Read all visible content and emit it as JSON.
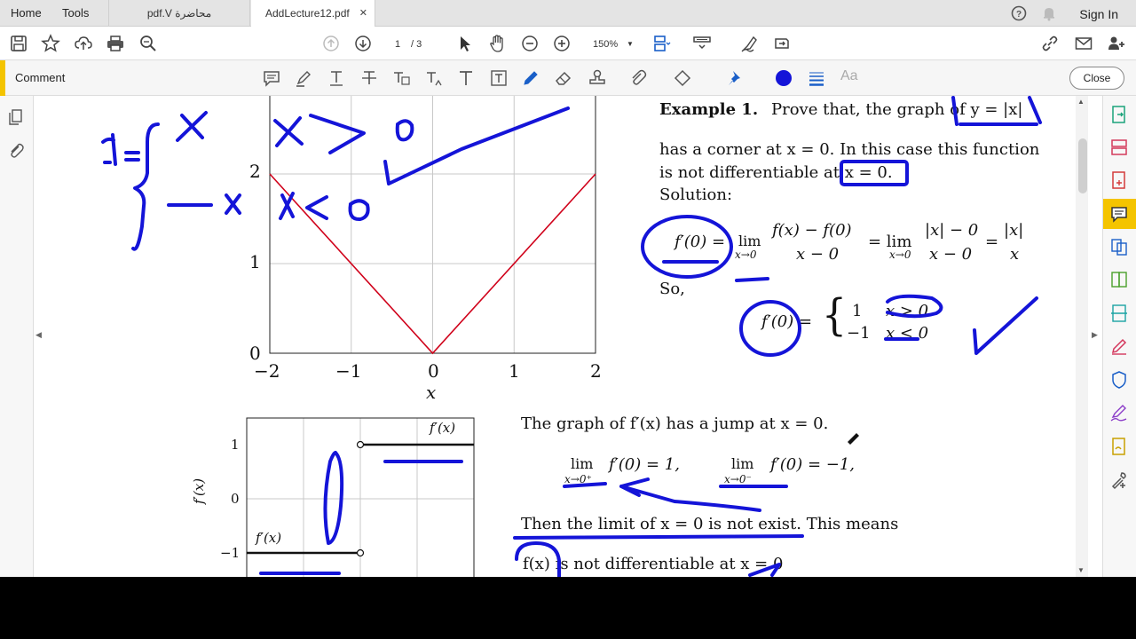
{
  "menu": {
    "home": "Home",
    "tools": "Tools"
  },
  "tabs": [
    {
      "label": "pdf.V محاضرة"
    },
    {
      "label": "AddLecture12.pdf"
    }
  ],
  "account": {
    "sign_in": "Sign In"
  },
  "nav": {
    "current_page": "1",
    "total_pages": "/ 3",
    "zoom": "150%"
  },
  "comment_toolbar": {
    "title": "Comment",
    "font_label": "Aa",
    "close_label": "Close"
  },
  "document": {
    "example_heading": "Example 1.",
    "example_text": "Prove that, the graph of y = |x|",
    "corner_line": "has a corner at x = 0. In this case this function",
    "not_diff_line": "is not differentiable at x = 0.",
    "solution_label": "Solution:",
    "derivative_lhs": "f′(0) =",
    "lim1": "lim",
    "lim1_sub": "x→0",
    "frac1_num": "f(x) − f(0)",
    "frac1_den": "x − 0",
    "eq_lim2": "= lim",
    "lim2_sub": "x→0",
    "frac2_num": "|x| − 0",
    "frac2_den": "x − 0",
    "eq3": "=",
    "frac3_num": "|x|",
    "frac3_den": "x",
    "so_label": "So,",
    "piece_lhs": "f′(0) =",
    "piece_v1": "1",
    "piece_c1": "x > 0",
    "piece_v2": "−1",
    "piece_c2": "x < 0",
    "jump_line": "The graph of f′(x) has a jump at x = 0.",
    "lim_right": "lim",
    "lim_right_sub": "x→0⁺",
    "lim_right_val": "f′(0) = 1,",
    "lim_left": "lim",
    "lim_left_sub": "x→0⁻",
    "lim_left_val": "f′(0) = −1,",
    "limit_line": "Then the limit of x = 0 is not exist. This means",
    "not_diff_fx": "f(x) is not differentiable at x = 0"
  },
  "chart_data": [
    {
      "type": "line",
      "title": "",
      "xlabel": "x",
      "ylabel": "",
      "xlim": [
        -2,
        2
      ],
      "ylim": [
        0,
        2.9
      ],
      "x_ticks": [
        "−2",
        "−1",
        "0",
        "1",
        "2"
      ],
      "y_ticks": [
        "0",
        "1",
        "2"
      ],
      "grid": true,
      "series": [
        {
          "x": [
            -2,
            0,
            2
          ],
          "y": [
            2,
            0,
            2
          ],
          "color": "#d0021b"
        }
      ]
    },
    {
      "type": "line",
      "title": "",
      "xlabel": "",
      "ylabel": "f′(x)",
      "xlim": [
        -2,
        1.5
      ],
      "ylim": [
        -1.3,
        1.5
      ],
      "y_ticks": [
        "1",
        "0",
        "−1"
      ],
      "grid": true,
      "series": [
        {
          "name": "f′(x)",
          "x": [
            0,
            2
          ],
          "y": [
            1,
            1
          ]
        },
        {
          "name": "f′(x)",
          "x": [
            -2,
            0
          ],
          "y": [
            -1,
            -1
          ]
        }
      ]
    }
  ],
  "colors": {
    "ink": "#1414d8",
    "accent": "#f4c400",
    "curve": "#d0021b"
  }
}
